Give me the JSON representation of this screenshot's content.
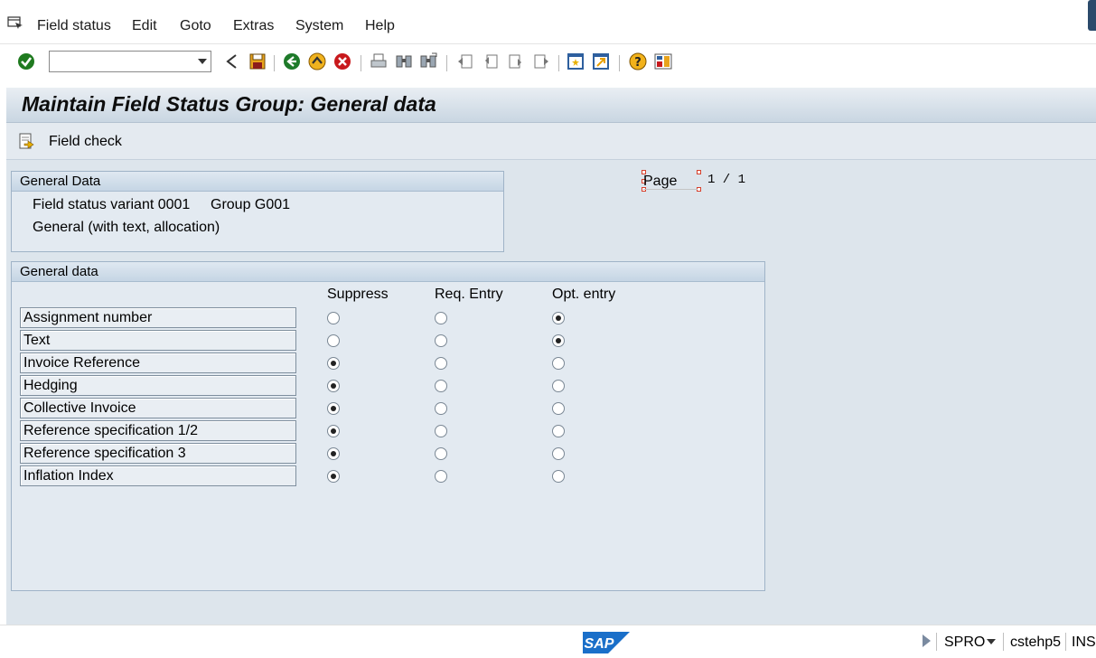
{
  "menu": {
    "items": [
      "Field status",
      "Edit",
      "Goto",
      "Extras",
      "System",
      "Help"
    ]
  },
  "toolbar": {
    "command_value": "",
    "icons": [
      "enter-icon",
      "back-arrow-icon",
      "save-icon",
      "back-icon",
      "exit-icon",
      "cancel-icon",
      "print-icon",
      "find-icon",
      "find-next-icon",
      "first-page-icon",
      "previous-page-icon",
      "next-page-icon",
      "last-page-icon",
      "create-session-icon",
      "shortcut-icon",
      "help-icon",
      "layout-icon"
    ]
  },
  "title": "Maintain Field Status Group: General data",
  "app_toolbar": {
    "field_check_label": "Field check"
  },
  "general_data_box": {
    "header": "General Data",
    "variant_text": "Field status variant 0001",
    "group_text": "Group G001",
    "description": "General (with text, allocation)"
  },
  "paging": {
    "label": "Page",
    "value": "1 / 1"
  },
  "fields_box": {
    "header": "General data",
    "columns": [
      "Suppress",
      "Req. Entry",
      "Opt. entry"
    ],
    "rows": [
      {
        "label": "Assignment number",
        "selected": 2
      },
      {
        "label": "Text",
        "selected": 2
      },
      {
        "label": "Invoice Reference",
        "selected": 0
      },
      {
        "label": "Hedging",
        "selected": 0
      },
      {
        "label": "Collective Invoice",
        "selected": 0
      },
      {
        "label": "Reference specification 1/2",
        "selected": 0
      },
      {
        "label": "Reference specification 3",
        "selected": 0
      },
      {
        "label": "Inflation Index",
        "selected": 0
      }
    ]
  },
  "status_bar": {
    "transaction": "SPRO",
    "server": "cstehp5",
    "mode": "INS",
    "logo_text": "SAP"
  },
  "colors": {
    "canvas": "#dde5ec",
    "sap_blue": "#1a6fc9"
  }
}
